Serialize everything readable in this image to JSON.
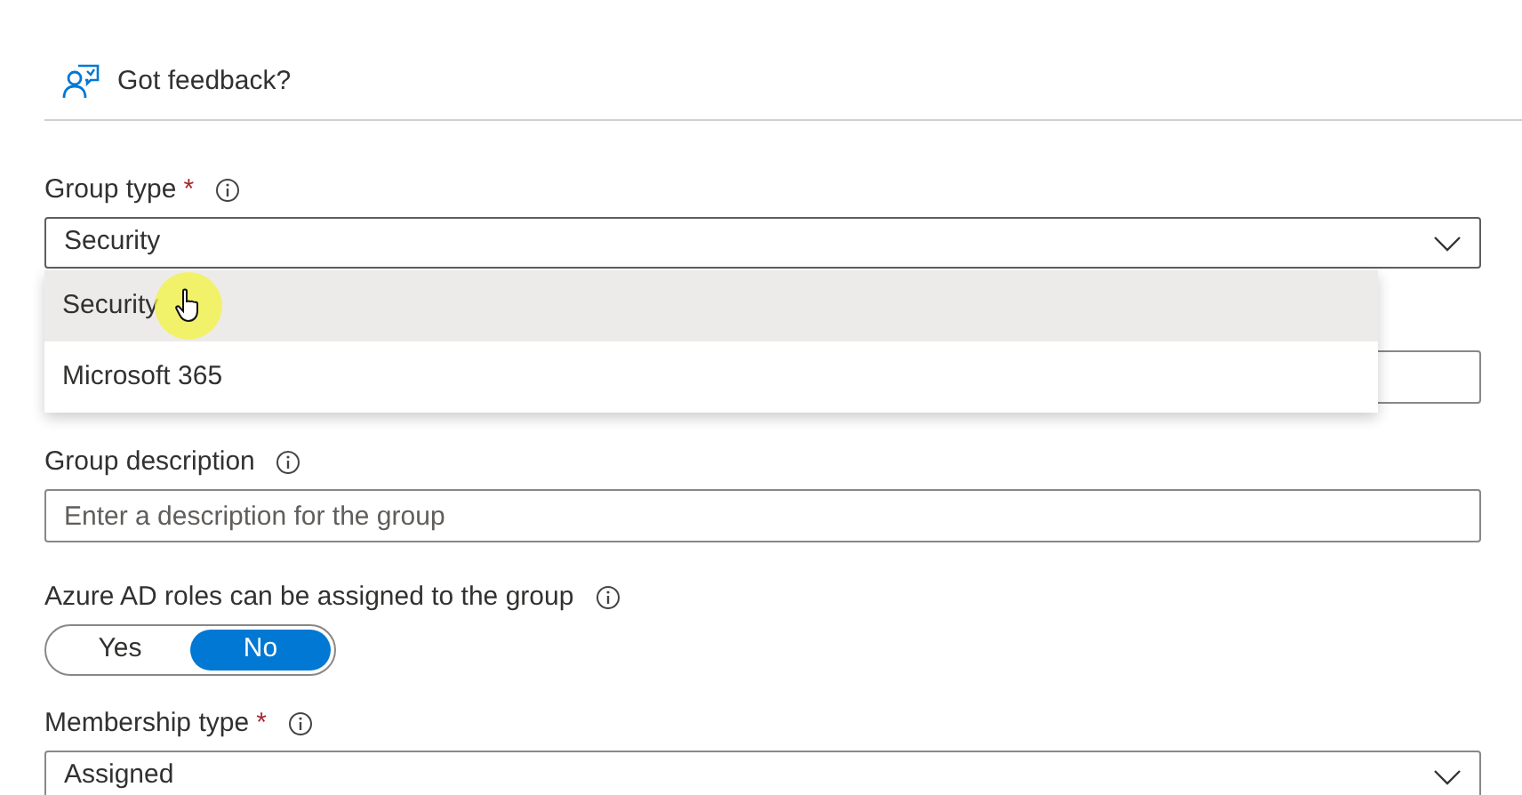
{
  "feedback": {
    "label": "Got feedback?"
  },
  "fields": [
    {
      "kind": "select",
      "label": "Group type",
      "required_mark": "*",
      "value": "Security",
      "expanded": true,
      "options": [
        {
          "label": "Security",
          "selected": true
        },
        {
          "label": "Microsoft 365",
          "selected": false
        }
      ]
    },
    {
      "kind": "text"
    },
    {
      "kind": "text",
      "label": "Group description",
      "placeholder": "Enter a description for the group"
    },
    {
      "kind": "toggle",
      "label": "Azure AD roles can be assigned to the group",
      "options": [
        {
          "label": "Yes",
          "selected": false
        },
        {
          "label": "No",
          "selected": true
        }
      ]
    },
    {
      "kind": "select",
      "label": "Membership type",
      "required_mark": "*",
      "value": "Assigned",
      "expanded": false
    }
  ]
}
